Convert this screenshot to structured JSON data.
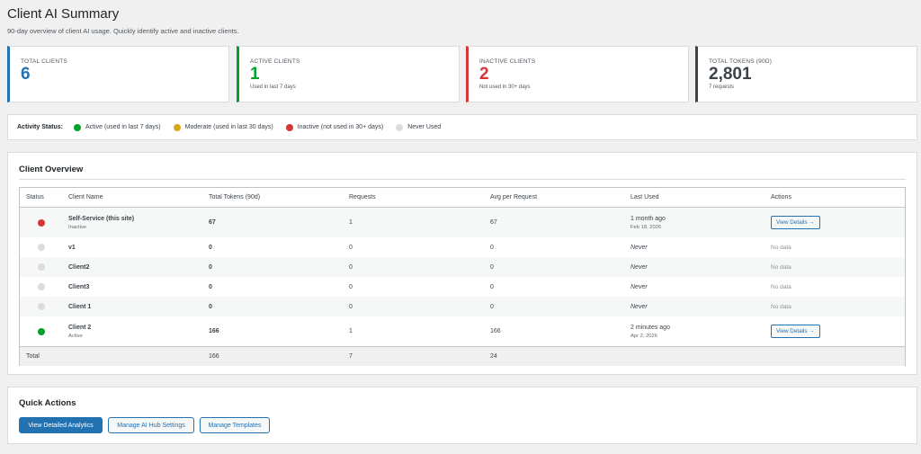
{
  "page": {
    "title": "Client AI Summary",
    "subtitle": "90-day overview of client AI usage. Quickly identify active and inactive clients."
  },
  "stats": [
    {
      "label": "TOTAL CLIENTS",
      "value": "6",
      "sub": "",
      "color": "#2271b1"
    },
    {
      "label": "ACTIVE CLIENTS",
      "value": "1",
      "sub": "Used in last 7 days",
      "color": "#00a32a"
    },
    {
      "label": "INACTIVE CLIENTS",
      "value": "2",
      "sub": "Not used in 30+ days",
      "color": "#d63638"
    },
    {
      "label": "TOTAL TOKENS (90D)",
      "value": "2,801",
      "sub": "7 requests",
      "color": "#3c434a"
    }
  ],
  "legend": {
    "title": "Activity Status:",
    "items": [
      {
        "label": "Active (used in last 7 days)",
        "color": "#00a32a"
      },
      {
        "label": "Moderate (used in last 30 days)",
        "color": "#dba617"
      },
      {
        "label": "Inactive (not used in 30+ days)",
        "color": "#d63638"
      },
      {
        "label": "Never Used",
        "color": "#dcdcde"
      }
    ]
  },
  "overview": {
    "title": "Client Overview",
    "columns": [
      "Status",
      "Client Name",
      "Total Tokens (90d)",
      "Requests",
      "Avg per Request",
      "Last Used",
      "Actions"
    ],
    "rows": [
      {
        "status_color": "#d63638",
        "name": "Self-Service (this site)",
        "state": "Inactive",
        "tokens": "67",
        "requests": "1",
        "avg": "67",
        "last_used": "1 month ago",
        "last_date": "Feb 18, 2026",
        "action": "View Details →"
      },
      {
        "status_color": "#dcdcde",
        "name": "v1",
        "state": "",
        "tokens": "0",
        "requests": "0",
        "avg": "0",
        "last_used": "Never",
        "last_date": "",
        "action": "No data"
      },
      {
        "status_color": "#dcdcde",
        "name": "Client2",
        "state": "",
        "tokens": "0",
        "requests": "0",
        "avg": "0",
        "last_used": "Never",
        "last_date": "",
        "action": "No data"
      },
      {
        "status_color": "#dcdcde",
        "name": "Client3",
        "state": "",
        "tokens": "0",
        "requests": "0",
        "avg": "0",
        "last_used": "Never",
        "last_date": "",
        "action": "No data"
      },
      {
        "status_color": "#dcdcde",
        "name": "Client 1",
        "state": "",
        "tokens": "0",
        "requests": "0",
        "avg": "0",
        "last_used": "Never",
        "last_date": "",
        "action": "No data"
      },
      {
        "status_color": "#00a32a",
        "name": "Client 2",
        "state": "Active",
        "tokens": "166",
        "requests": "1",
        "avg": "166",
        "last_used": "2 minutes ago",
        "last_date": "Apr 2, 2026",
        "action": "View Details →"
      }
    ],
    "total": {
      "label": "Total",
      "tokens": "166",
      "requests": "7",
      "avg": "24"
    }
  },
  "quick_actions": {
    "title": "Quick Actions",
    "buttons": [
      "View Detailed Analytics",
      "Manage AI Hub Settings",
      "Manage Templates"
    ]
  }
}
